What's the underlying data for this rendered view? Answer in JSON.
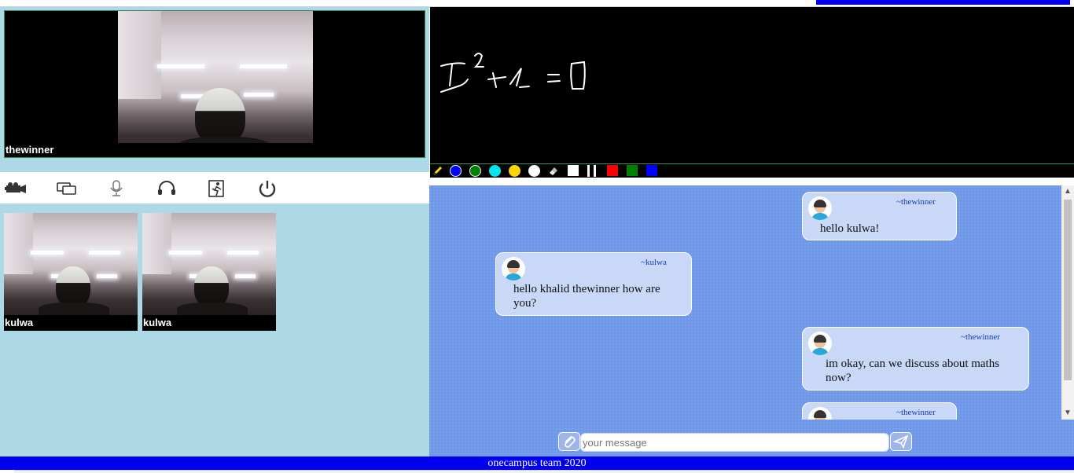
{
  "main_video": {
    "participant": "thewinner"
  },
  "thumbnails": [
    {
      "participant": "kulwa"
    },
    {
      "participant": "kulwa"
    }
  ],
  "controls": [
    {
      "icon": "video-camera-icon"
    },
    {
      "icon": "screen-share-icon"
    },
    {
      "icon": "microphone-icon"
    },
    {
      "icon": "headphones-icon"
    },
    {
      "icon": "leave-room-icon"
    },
    {
      "icon": "power-icon"
    }
  ],
  "whiteboard": {
    "drawn_text": "x^2 + 1 = 0",
    "tools": [
      "pencil",
      "blue",
      "green",
      "cyan",
      "yellow",
      "white",
      "eraser",
      "white-square",
      "thin-line",
      "thick-line",
      "red",
      "green-square",
      "blue-square"
    ],
    "colors": {
      "blue": "#0000ff",
      "green": "#008000",
      "cyan": "#00e5ee",
      "yellow": "#ffd700",
      "white": "#ffffff",
      "red": "#ff0000"
    }
  },
  "chat": {
    "messages": [
      {
        "sender": "~thewinner",
        "text": "hello kulwa!",
        "side": "right"
      },
      {
        "sender": "~kulwa",
        "text": "hello khalid thewinner how are you?",
        "side": "left"
      },
      {
        "sender": "~thewinner",
        "text": "im okay, can we discuss about maths now?",
        "side": "right"
      },
      {
        "sender": "~thewinner",
        "text": "",
        "side": "right"
      }
    ],
    "input_placeholder": "your message"
  },
  "footer": {
    "text": "onecampus team 2020"
  },
  "colors": {
    "accent": "#0000ee",
    "left_bg": "#add8e6",
    "chat_bg": "#6f98e8",
    "bubble": "#c9d8f7"
  }
}
